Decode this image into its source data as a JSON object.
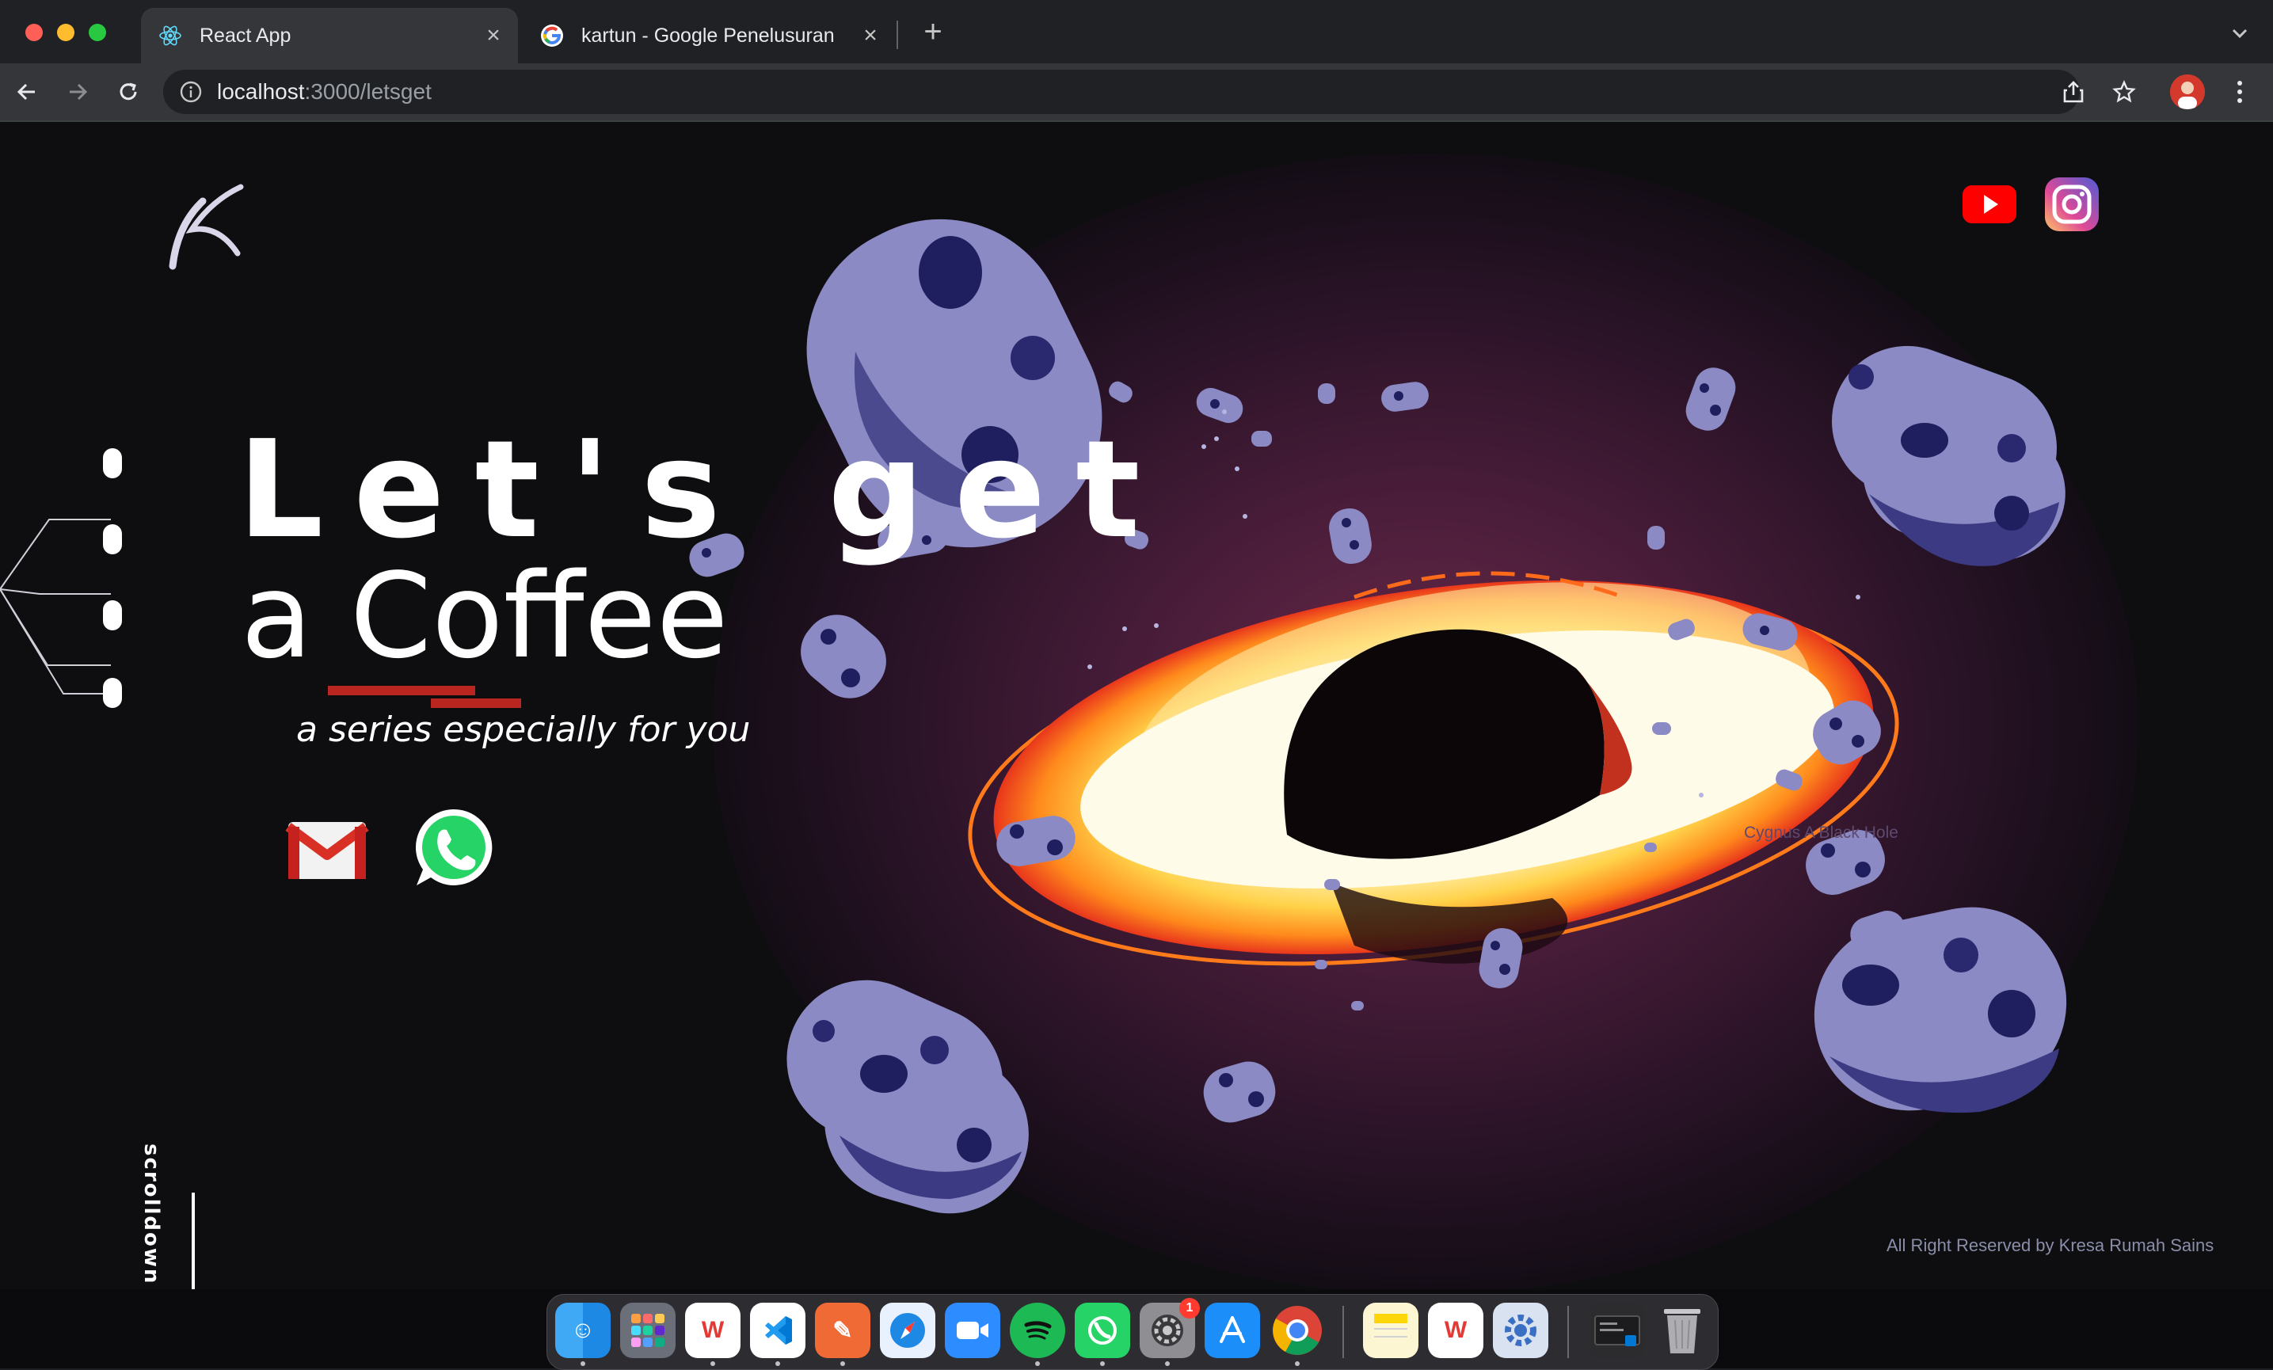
{
  "browser": {
    "tabs": [
      {
        "title": "React App",
        "icon": "react-icon",
        "active": true
      },
      {
        "title": "kartun - Google Penelusuran",
        "icon": "google-icon",
        "active": false
      }
    ],
    "url_host": "localhost",
    "url_path": ":3000/letsget"
  },
  "page": {
    "headline": "Let's get",
    "subline": "a Coffee",
    "tagline": "a series especially for you",
    "scroll_label": "scrolldown",
    "caption": "Cygnus A Black Hole",
    "footer": "All Right Reserved by Kresa Rumah Sains",
    "social": [
      "youtube-icon",
      "instagram-icon"
    ],
    "contacts": [
      "gmail-icon",
      "whatsapp-icon"
    ],
    "colors": {
      "accent": "#b8261f",
      "asteroid": "#8b8ac4",
      "asteroid_dark": "#3b3a82"
    }
  },
  "dock": {
    "apps": [
      "finder",
      "launchpad",
      "wps-office",
      "vscode",
      "pen-app",
      "safari",
      "zoom",
      "spotify",
      "whatsapp",
      "system-preferences",
      "app-store",
      "chrome",
      "notes",
      "wps-office",
      "settings",
      "terminal",
      "trash"
    ],
    "badge": "1"
  }
}
